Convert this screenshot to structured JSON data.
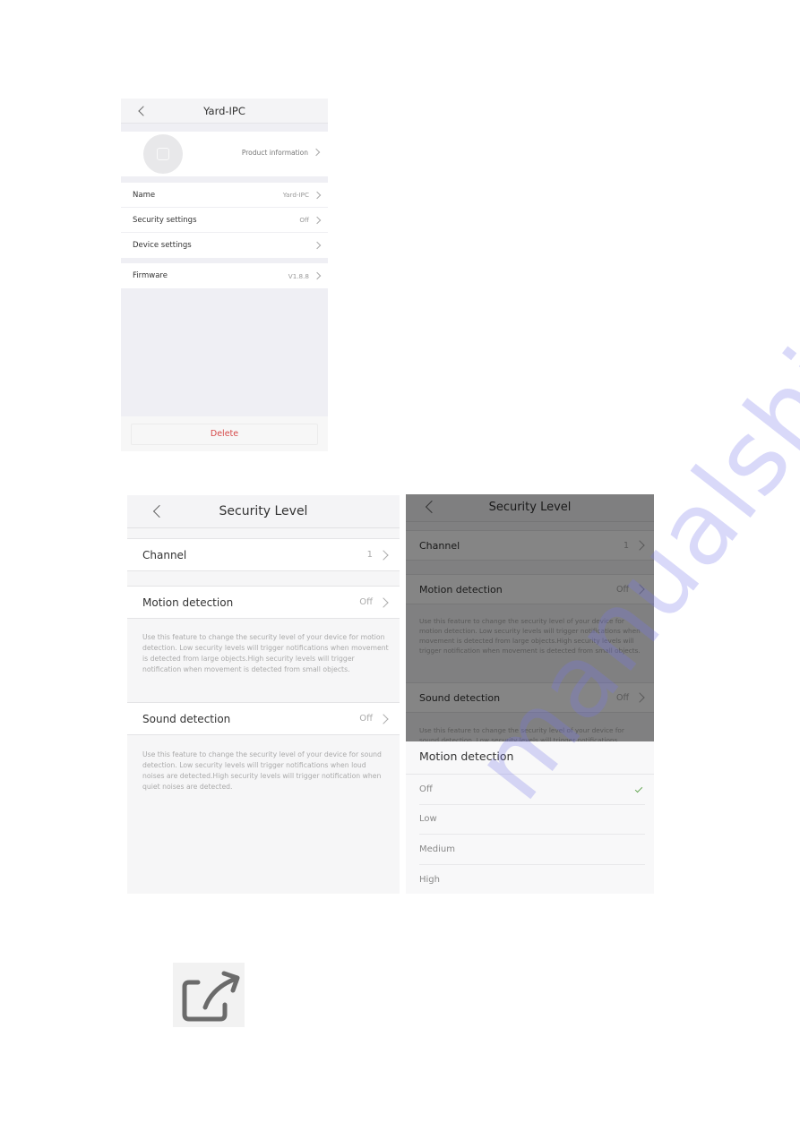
{
  "screen1": {
    "nav_title": "Yard-IPC",
    "product_info_label": "Product information",
    "rows": [
      {
        "label": "Name",
        "value": "Yard-IPC"
      },
      {
        "label": "Security settings",
        "value": "Off"
      },
      {
        "label": "Device settings",
        "value": ""
      }
    ],
    "firmware": {
      "label": "Firmware",
      "value": "V1.8.8"
    },
    "delete_label": "Delete",
    "colors": {
      "delete": "#d64a4a"
    }
  },
  "screen2": {
    "nav_title": "Security Level",
    "channel": {
      "label": "Channel",
      "value": "1"
    },
    "motion": {
      "label": "Motion detection",
      "value": "Off"
    },
    "motion_desc": "Use this feature to change the security level of your device for motion detection. Low security levels will trigger notifications when movement is detected from large objects.High security levels will trigger notification when movement is detected from small objects.",
    "sound": {
      "label": "Sound detection",
      "value": "Off"
    },
    "sound_desc": "Use this feature to change the security level of your device for sound detection. Low security levels will trigger notifications when loud noises are detected.High security levels will trigger notification when quiet noises are detected."
  },
  "screen3": {
    "nav_title": "Security Level",
    "channel": {
      "label": "Channel",
      "value": "1"
    },
    "motion": {
      "label": "Motion detection",
      "value": "Off"
    },
    "motion_desc": "Use this feature to change the security level of your device for motion detection. Low security levels will trigger notifications when movement is detected from large objects.High security levels will trigger notification when movement is detected from small objects.",
    "sound": {
      "label": "Sound detection",
      "value": "Off"
    },
    "sound_desc": "Use this feature to change the security level of your device for sound detection. Low security levels will trigger notifications",
    "sheet": {
      "title": "Motion detection",
      "options": [
        "Off",
        "Low",
        "Medium",
        "High"
      ],
      "selected": "Off",
      "check_color": "#6aaa5a"
    }
  },
  "share_icon": "share-external-icon",
  "watermark": "manualshive.com"
}
